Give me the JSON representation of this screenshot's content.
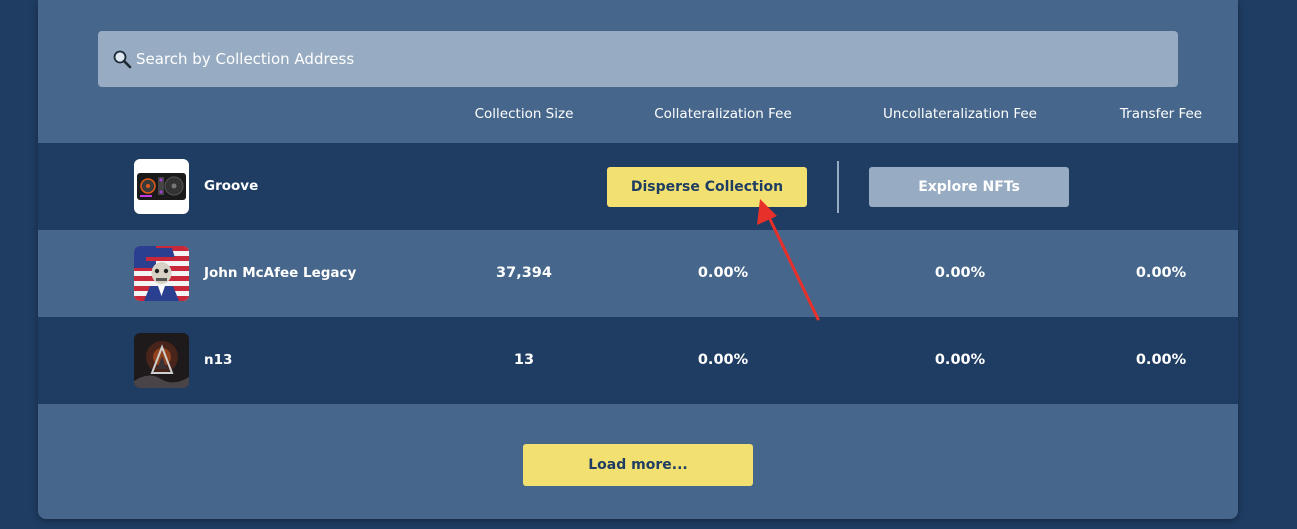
{
  "search": {
    "placeholder": "Search by Collection Address"
  },
  "columns": {
    "size": "Collection Size",
    "collateralization": "Collateralization Fee",
    "uncollateralization": "Uncollateralization Fee",
    "transfer": "Transfer Fee"
  },
  "rows": [
    {
      "name": "Groove",
      "disperse_label": "Disperse Collection",
      "explore_label": "Explore NFTs"
    },
    {
      "name": "John McAfee Legacy",
      "size": "37,394",
      "collateralization": "0.00%",
      "uncollateralization": "0.00%",
      "transfer": "0.00%"
    },
    {
      "name": "n13",
      "size": "13",
      "collateralization": "0.00%",
      "uncollateralization": "0.00%",
      "transfer": "0.00%"
    }
  ],
  "load_more_label": "Load more...",
  "colors": {
    "page_bg": "#1f3d63",
    "panel_bg": "#46678b",
    "accent_yellow": "#f2e170",
    "muted_button": "#97abc2",
    "annotation_red": "#e8302a"
  }
}
